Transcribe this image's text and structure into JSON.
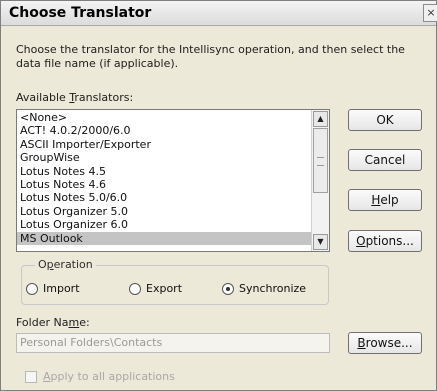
{
  "window": {
    "title": "Choose Translator",
    "close_glyph": "×"
  },
  "instructions": "Choose the translator for the Intellisync operation, and then select the data file name (if applicable).",
  "available_label": {
    "pre": "Available ",
    "accel": "T",
    "post": "ranslators:"
  },
  "translators": [
    "<None>",
    "ACT! 4.0.2/2000/6.0",
    "ASCII Importer/Exporter",
    "GroupWise",
    "Lotus Notes 4.5",
    "Lotus Notes 4.6",
    "Lotus Notes 5.0/6.0",
    "Lotus Organizer 5.0",
    "Lotus Organizer 6.0",
    "MS Outlook"
  ],
  "selected_translator": "MS Outlook",
  "buttons": {
    "ok": "OK",
    "cancel": "Cancel",
    "help": {
      "accel": "H",
      "rest": "elp"
    },
    "options": {
      "accel": "O",
      "rest": "ptions..."
    },
    "browse": {
      "accel": "B",
      "rest": "rowse..."
    }
  },
  "operation": {
    "title": {
      "pre": "O",
      "accel": "p",
      "post": "eration"
    },
    "options": [
      "Import",
      "Export",
      "Synchronize"
    ],
    "selected": "Synchronize"
  },
  "folder": {
    "label": {
      "pre": "Folder Na",
      "accel": "m",
      "post": "e:"
    },
    "value": "Personal Folders\\Contacts"
  },
  "apply_all": {
    "accel": "A",
    "rest": "pply to all applications",
    "checked": false
  },
  "icons": {
    "scroll_up": "▲",
    "scroll_down": "▼",
    "close": "close-icon"
  }
}
